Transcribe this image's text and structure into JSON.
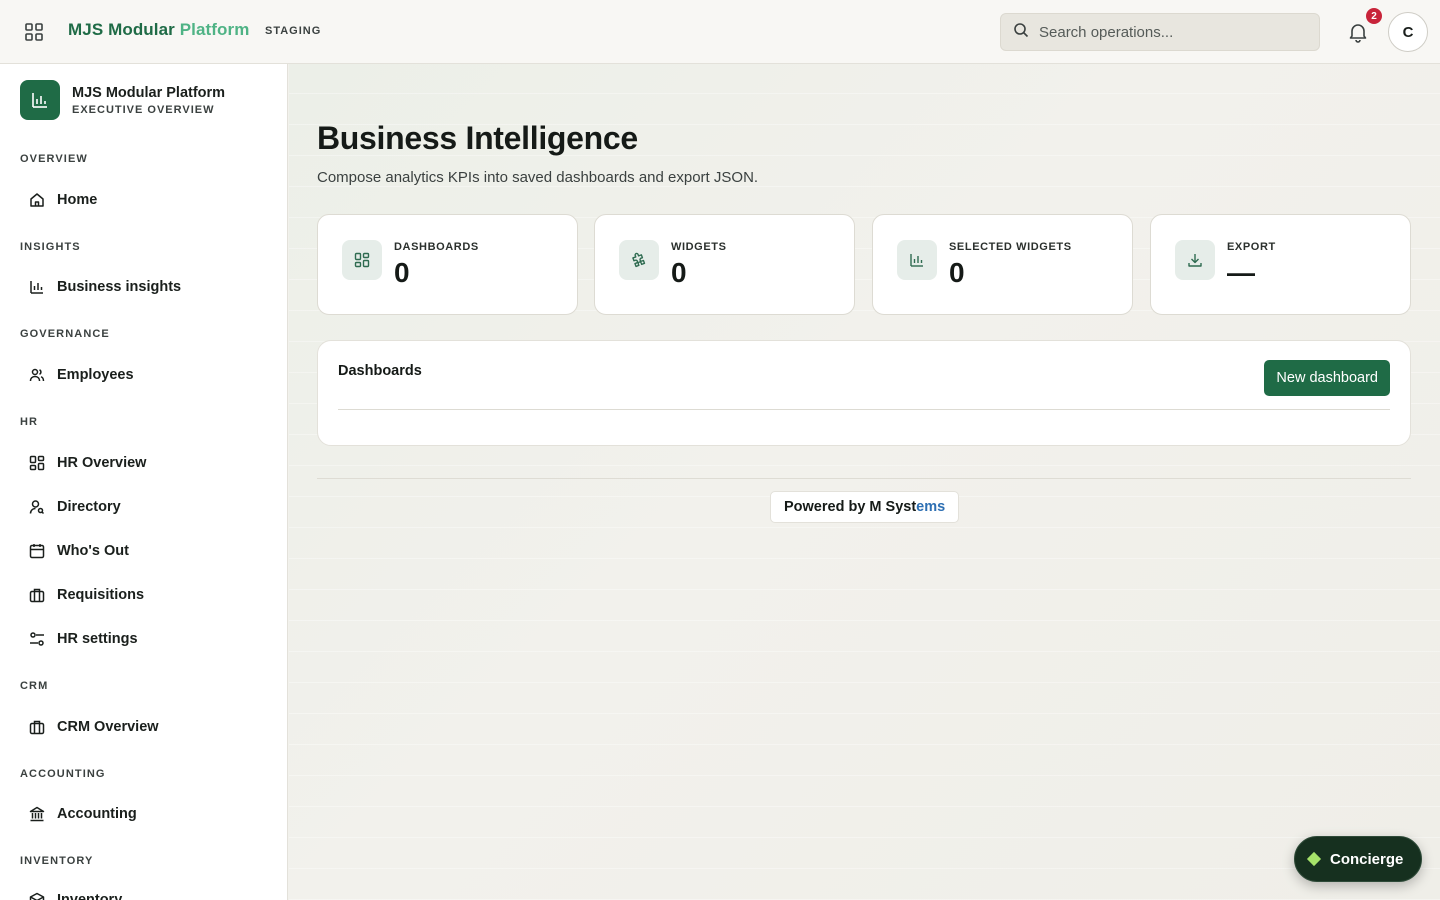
{
  "header": {
    "brand_main": "MJS Modular ",
    "brand_accent": "Platform",
    "env": "STAGING",
    "search_placeholder": "Search operations...",
    "notification_count": "2",
    "avatar_initial": "C",
    "brand_color": "#1f6b46"
  },
  "sidebar": {
    "workspace_title": "MJS Modular Platform",
    "workspace_subtitle": "EXECUTIVE OVERVIEW",
    "sections": {
      "overview": "OVERVIEW",
      "insights": "INSIGHTS",
      "governance": "GOVERNANCE",
      "hr": "HR",
      "crm": "CRM",
      "accounting": "ACCOUNTING",
      "inventory": "INVENTORY"
    },
    "items": {
      "home": "Home",
      "business_insights": "Business insights",
      "employees": "Employees",
      "hr_overview": "HR Overview",
      "directory": "Directory",
      "whos_out": "Who's Out",
      "requisitions": "Requisitions",
      "hr_settings": "HR settings",
      "crm_overview": "CRM Overview",
      "accounting": "Accounting",
      "inventory": "Inventory"
    }
  },
  "main": {
    "title": "Business Intelligence",
    "subtitle": "Compose analytics KPIs into saved dashboards and export JSON.",
    "kpis": [
      {
        "label": "DASHBOARDS",
        "value": "0",
        "icon": "grid-icon"
      },
      {
        "label": "WIDGETS",
        "value": "0",
        "icon": "puzzle-icon"
      },
      {
        "label": "SELECTED WIDGETS",
        "value": "0",
        "icon": "bar-chart-icon"
      },
      {
        "label": "EXPORT",
        "value": "—",
        "icon": "download-icon"
      }
    ],
    "panel": {
      "title": "Dashboards",
      "new_button": "New dashboard"
    },
    "powered_main": "Powered by M Syst",
    "powered_tail": "ems"
  },
  "concierge": {
    "label": "Concierge"
  }
}
